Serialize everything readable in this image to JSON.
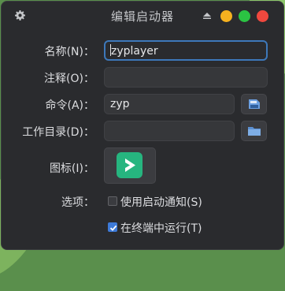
{
  "window": {
    "title": "编辑启动器"
  },
  "form": {
    "name": {
      "label": "名称(N)：",
      "value": "zyplayer"
    },
    "comment": {
      "label": "注释(O)：",
      "value": ""
    },
    "command": {
      "label": "命令(A)：",
      "value": "zyp"
    },
    "workdir": {
      "label": "工作目录(D)：",
      "value": ""
    },
    "icon": {
      "label": "图标(I)："
    },
    "options": {
      "label": "选项：",
      "startup_notify": {
        "label": "使用启动通知(S)",
        "checked": false
      },
      "run_in_terminal": {
        "label": "在终端中运行(T)",
        "checked": true
      }
    }
  },
  "colors": {
    "window_bg": "#2a2b2e",
    "focus_border": "#3d78ba",
    "checkbox_checked": "#3d7ad8",
    "app_icon_bg": "#26b57f",
    "btn_min": "#f6b11f",
    "btn_max": "#2bc343",
    "btn_close": "#f0483e",
    "folder_icon": "#5b8fd1"
  },
  "icons": [
    "gear-icon",
    "eject-icon",
    "document-icon",
    "folder-icon",
    "zyplayer-app-icon",
    "checkmark-icon"
  ]
}
